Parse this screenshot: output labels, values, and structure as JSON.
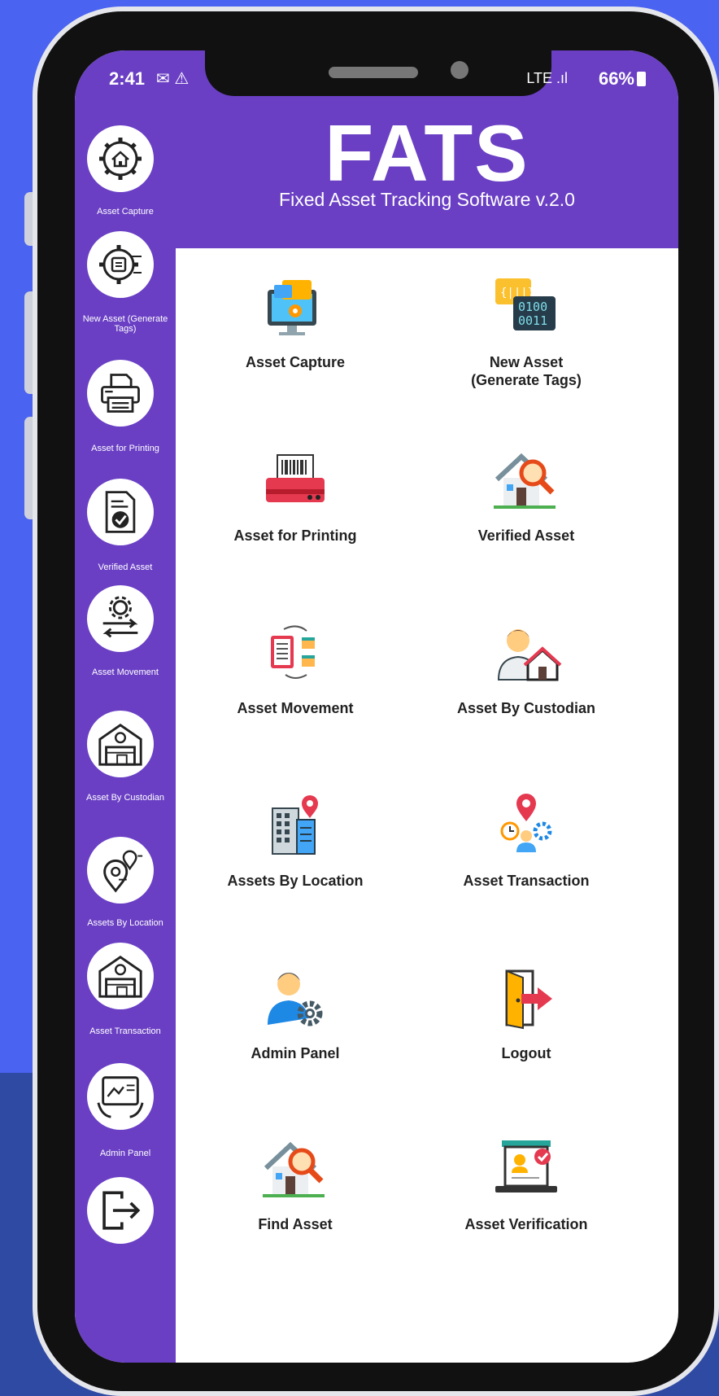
{
  "status_bar": {
    "time": "2:41",
    "notification_icons": "✉ ⚠",
    "signal": "LTE .ıl",
    "battery": "66%"
  },
  "header": {
    "title": "FATS",
    "subtitle": "Fixed Asset Tracking Software v.2.0"
  },
  "sidebar": {
    "items": [
      {
        "label": "Asset Capture",
        "icon": "gear-home-icon"
      },
      {
        "label": "New Asset (Generate Tags)",
        "icon": "chip-gear-icon"
      },
      {
        "label": "Asset for Printing",
        "icon": "printer-icon"
      },
      {
        "label": "Verified Asset",
        "icon": "document-check-icon"
      },
      {
        "label": "Asset Movement",
        "icon": "gear-arrows-icon"
      },
      {
        "label": "Asset By Custodian",
        "icon": "warehouse-icon"
      },
      {
        "label": "Assets By Location",
        "icon": "location-pins-icon"
      },
      {
        "label": "Asset Transaction",
        "icon": "warehouse-icon"
      },
      {
        "label": "Admin Panel",
        "icon": "tablet-hands-icon"
      },
      {
        "label": "",
        "icon": "logout-icon"
      }
    ]
  },
  "menu": {
    "items": [
      {
        "label": "Asset Capture",
        "icon": "computer-settings-icon"
      },
      {
        "label": "New Asset (Generate Tags)",
        "icon": "binary-code-icon"
      },
      {
        "label": "Asset for Printing",
        "icon": "barcode-printer-icon"
      },
      {
        "label": "Verified Asset",
        "icon": "house-search-icon"
      },
      {
        "label": "Asset Movement",
        "icon": "clipboard-boxes-icon"
      },
      {
        "label": "Asset By Custodian",
        "icon": "person-house-icon"
      },
      {
        "label": "Assets By Location",
        "icon": "building-pin-icon"
      },
      {
        "label": "Asset Transaction",
        "icon": "pin-person-gear-icon"
      },
      {
        "label": "Admin Panel",
        "icon": "user-gear-icon"
      },
      {
        "label": "Logout",
        "icon": "door-exit-icon"
      },
      {
        "label": "Find Asset",
        "icon": "house-search-icon"
      },
      {
        "label": "Asset Verification",
        "icon": "laptop-profile-check-icon"
      }
    ]
  },
  "colors": {
    "purple": "#6a3fc4",
    "background_blue": "#4a63f0",
    "background_dark_blue": "#2f4aa3"
  }
}
